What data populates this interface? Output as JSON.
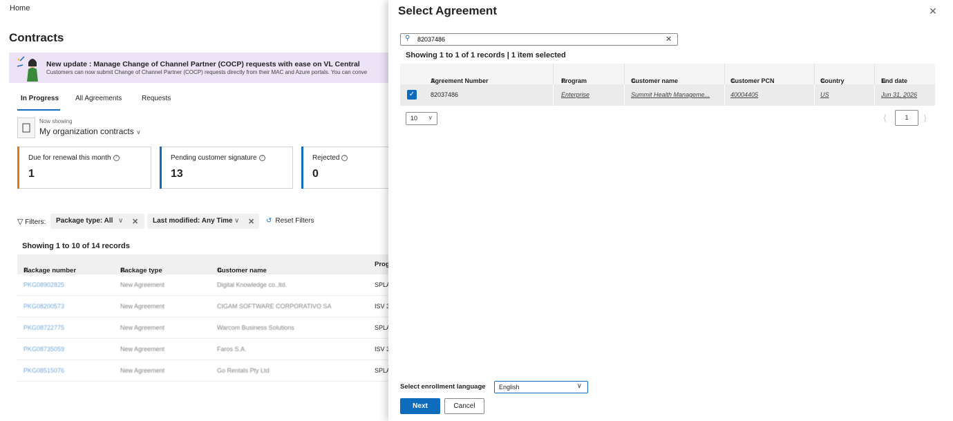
{
  "background": {
    "breadcrumb": "Home",
    "page_title": "Contracts",
    "banner": {
      "title": "New update : Manage Change of Channel Partner (COCP) requests with ease on VL Central",
      "text": "Customers can now submit Change of Channel Partner (COCP) requests directly from their MAC and Azure portals. You can conve"
    },
    "tabs": [
      "In Progress",
      "All Agreements",
      "Requests"
    ],
    "now_showing_label": "Now showing",
    "now_showing_value": "My organization contracts",
    "cards": [
      {
        "title": "Due for renewal this month",
        "value": "1",
        "accent": "#e07a10"
      },
      {
        "title": "Pending customer signature",
        "value": "13",
        "accent": "#0f6cbd"
      },
      {
        "title": "Rejected",
        "value": "0",
        "accent": "#0f6cbd"
      }
    ],
    "filters": {
      "label": "Filters:",
      "package_type": "Package type:  All",
      "last_modified": "Last modified: Any Time",
      "reset": "Reset Filters"
    },
    "records_text": "Showing 1 to 10 of 14 records",
    "table": {
      "headers": [
        "Package number",
        "Package type",
        "Customer name",
        "Prog"
      ],
      "rows": [
        [
          "PKG08902825",
          "New Agreement",
          "Digital Knowledge co.,ltd.",
          "SPLA"
        ],
        [
          "PKG08200573",
          "New Agreement",
          "CIGAM SOFTWARE CORPORATIVO SA",
          "ISV 3"
        ],
        [
          "PKG08722775",
          "New Agreement",
          "Warcom Business Solutions",
          "SPLA"
        ],
        [
          "PKG08735059",
          "New Agreement",
          "Faros S.A.",
          "ISV 3"
        ],
        [
          "PKG08515076",
          "New Agreement",
          "Go Rentals Pty Ltd",
          "SPLA"
        ]
      ]
    }
  },
  "panel": {
    "title": "Select Agreement",
    "search_value": "82037486",
    "records_text": "Showing 1 to 1 of 1 records | 1 item selected",
    "headers": [
      "Agreement Number",
      "Program",
      "Customer name",
      "Customer PCN",
      "Country",
      "End date"
    ],
    "row": {
      "agreement_number": "82037486",
      "program": "Enterprise",
      "customer_name": "Summit Health Manageme...",
      "customer_pcn": "40004405",
      "country": "US",
      "end_date": "Jun 31, 2026"
    },
    "page_size": "10",
    "current_page": "1",
    "language_label": "Select enrollment language",
    "language_value": "English",
    "next_button": "Next",
    "cancel_button": "Cancel"
  }
}
